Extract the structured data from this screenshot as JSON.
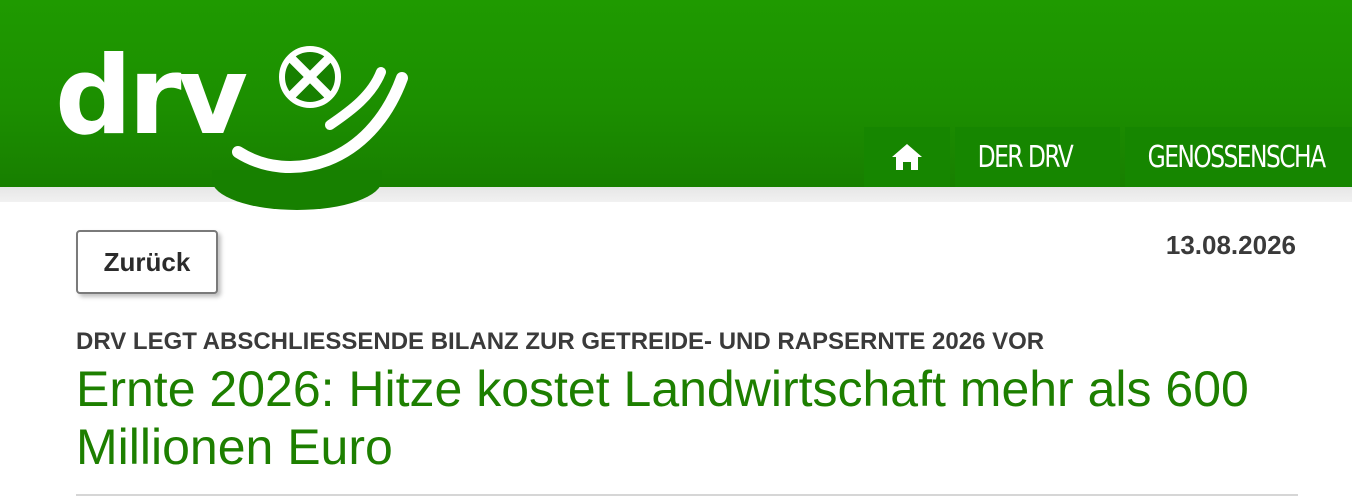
{
  "header": {
    "logo_text": "drv",
    "logo_icon": "raiffeisen-cross-icon"
  },
  "nav": {
    "home_icon": "home-icon",
    "items": [
      {
        "label": "DER DRV"
      },
      {
        "label": "GENOSSENSCHA"
      }
    ]
  },
  "colors": {
    "brand_green": "#1c8f00",
    "nav_green": "#168600",
    "headline_green": "#1d7f00",
    "text_dark": "#3a3a3a"
  },
  "article": {
    "back_label": "Zurück",
    "date": "13.08.2026",
    "kicker": "DRV LEGT ABSCHLIESSENDE BILANZ ZUR GETREIDE- UND RAPSERNTE 2026 VOR",
    "headline": "Ernte 2026: Hitze kostet Landwirtschaft mehr als 600 Millionen Euro"
  }
}
